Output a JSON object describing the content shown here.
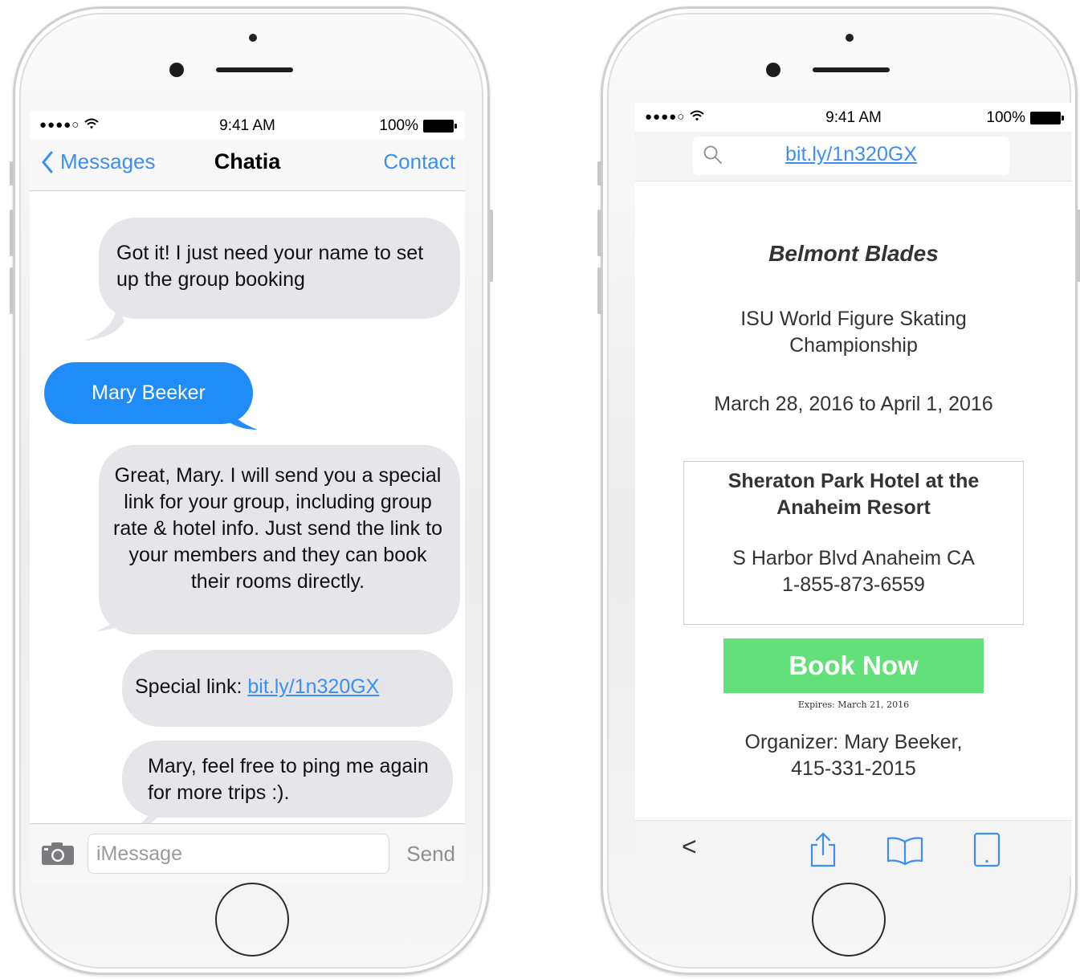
{
  "status_bar": {
    "signal": "●●●●○",
    "time": "9:41 AM",
    "battery": "100%"
  },
  "messages": {
    "back_label": "Messages",
    "title": "Chatia",
    "contact_label": "Contact",
    "bubbles": [
      {
        "text": "Got it! I just need your name to set up the group booking"
      },
      {
        "text": "Mary Beeker"
      },
      {
        "text": "Great, Mary.  I will send you a special link for your group, including group rate & hotel info. Just send the link to your members and they can book their rooms directly."
      },
      {
        "prefix": "Special link: ",
        "link": "bit.ly/1n320GX"
      },
      {
        "text": "Mary, feel free to ping me again for more trips :)."
      }
    ],
    "input_placeholder": "iMessage",
    "send_label": "Send"
  },
  "browser": {
    "url": "bit.ly/1n320GX",
    "page": {
      "title": "Belmont Blades",
      "event": "ISU World Figure Skating Championship",
      "dates": "March 28, 2016 to April 1, 2016",
      "hotel_name": "Sheraton Park Hotel at the Anaheim Resort",
      "hotel_address": "S Harbor Blvd Anaheim CA",
      "hotel_phone": "1-855-873-6559",
      "book_label": "Book Now",
      "expires": "Expires:  March 21, 2016",
      "organizer_line1": "Organizer:  Mary Beeker,",
      "organizer_line2": "415-331-2015"
    },
    "toolbar": {
      "back_glyph": "<"
    }
  },
  "colors": {
    "ios_blue": "#3b8ff3",
    "outgoing_bubble": "#1f8cf8",
    "incoming_bubble": "#e5e5ea",
    "book_button": "#64e07a"
  }
}
